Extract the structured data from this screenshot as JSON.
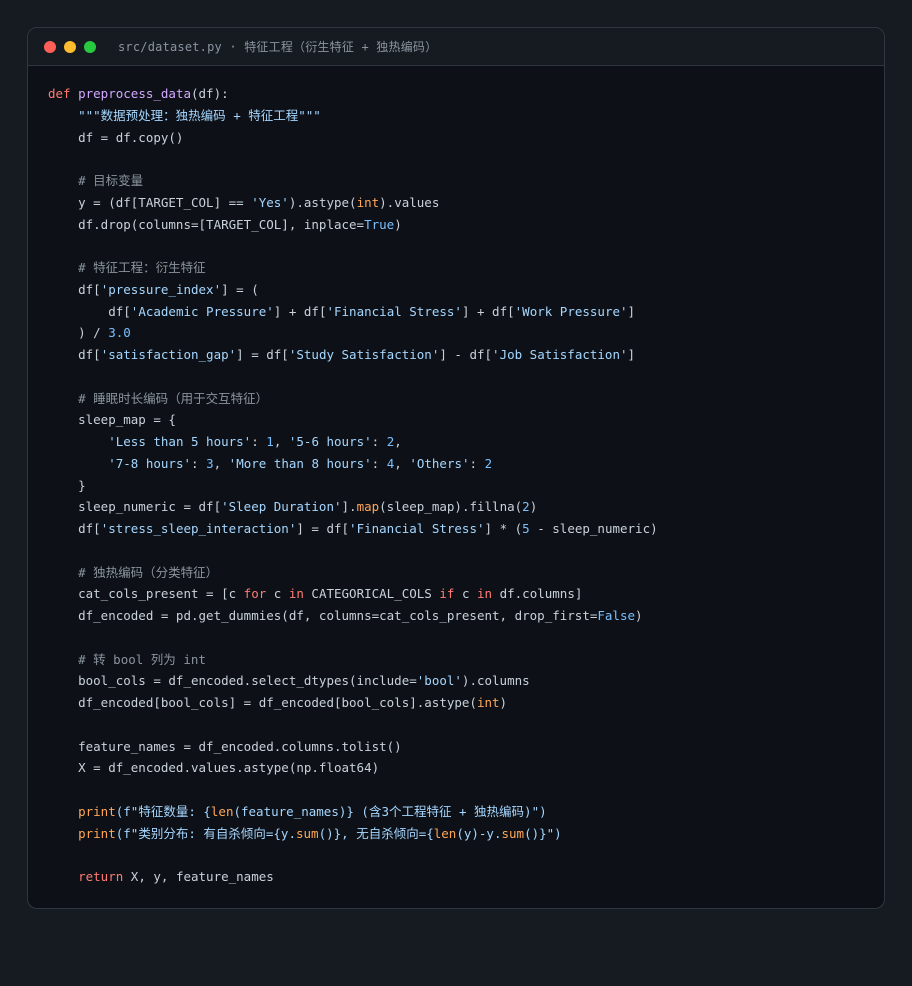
{
  "window": {
    "title": "src/dataset.py · 特征工程（衍生特征 + 独热编码）",
    "dots": [
      {
        "name": "close",
        "color": "#ff5f57"
      },
      {
        "name": "minimize",
        "color": "#febc2e"
      },
      {
        "name": "maximize",
        "color": "#28c840"
      }
    ]
  },
  "code": {
    "lines": [
      [
        {
          "t": "def ",
          "c": "kw"
        },
        {
          "t": "preprocess_data",
          "c": "fn"
        },
        {
          "t": "(df):",
          "c": ""
        }
      ],
      [
        {
          "t": "    \"\"\"数据预处理：独热编码 + 特征工程\"\"\"",
          "c": "str"
        }
      ],
      [
        {
          "t": "    df = df.copy()",
          "c": ""
        }
      ],
      [],
      [
        {
          "t": "    # 目标变量",
          "c": "cm"
        }
      ],
      [
        {
          "t": "    y = (df[TARGET_COL] == ",
          "c": ""
        },
        {
          "t": "'Yes'",
          "c": "str"
        },
        {
          "t": ").astype(",
          "c": ""
        },
        {
          "t": "int",
          "c": "bi"
        },
        {
          "t": ").values",
          "c": ""
        }
      ],
      [
        {
          "t": "    df.drop(columns=[TARGET_COL], inplace=",
          "c": ""
        },
        {
          "t": "True",
          "c": "const"
        },
        {
          "t": ")",
          "c": ""
        }
      ],
      [],
      [
        {
          "t": "    # 特征工程：衍生特征",
          "c": "cm"
        }
      ],
      [
        {
          "t": "    df[",
          "c": ""
        },
        {
          "t": "'pressure_index'",
          "c": "str"
        },
        {
          "t": "] = (",
          "c": ""
        }
      ],
      [
        {
          "t": "        df[",
          "c": ""
        },
        {
          "t": "'Academic Pressure'",
          "c": "str"
        },
        {
          "t": "] + df[",
          "c": ""
        },
        {
          "t": "'Financial Stress'",
          "c": "str"
        },
        {
          "t": "] + df[",
          "c": ""
        },
        {
          "t": "'Work Pressure'",
          "c": "str"
        },
        {
          "t": "]",
          "c": ""
        }
      ],
      [
        {
          "t": "    ) / ",
          "c": ""
        },
        {
          "t": "3.0",
          "c": "num"
        }
      ],
      [
        {
          "t": "    df[",
          "c": ""
        },
        {
          "t": "'satisfaction_gap'",
          "c": "str"
        },
        {
          "t": "] = df[",
          "c": ""
        },
        {
          "t": "'Study Satisfaction'",
          "c": "str"
        },
        {
          "t": "] - df[",
          "c": ""
        },
        {
          "t": "'Job Satisfaction'",
          "c": "str"
        },
        {
          "t": "]",
          "c": ""
        }
      ],
      [],
      [
        {
          "t": "    # 睡眠时长编码（用于交互特征）",
          "c": "cm"
        }
      ],
      [
        {
          "t": "    sleep_map = {",
          "c": ""
        }
      ],
      [
        {
          "t": "        ",
          "c": ""
        },
        {
          "t": "'Less than 5 hours'",
          "c": "str"
        },
        {
          "t": ": ",
          "c": ""
        },
        {
          "t": "1",
          "c": "num"
        },
        {
          "t": ", ",
          "c": ""
        },
        {
          "t": "'5-6 hours'",
          "c": "str"
        },
        {
          "t": ": ",
          "c": ""
        },
        {
          "t": "2",
          "c": "num"
        },
        {
          "t": ",",
          "c": ""
        }
      ],
      [
        {
          "t": "        ",
          "c": ""
        },
        {
          "t": "'7-8 hours'",
          "c": "str"
        },
        {
          "t": ": ",
          "c": ""
        },
        {
          "t": "3",
          "c": "num"
        },
        {
          "t": ", ",
          "c": ""
        },
        {
          "t": "'More than 8 hours'",
          "c": "str"
        },
        {
          "t": ": ",
          "c": ""
        },
        {
          "t": "4",
          "c": "num"
        },
        {
          "t": ", ",
          "c": ""
        },
        {
          "t": "'Others'",
          "c": "str"
        },
        {
          "t": ": ",
          "c": ""
        },
        {
          "t": "2",
          "c": "num"
        }
      ],
      [
        {
          "t": "    }",
          "c": ""
        }
      ],
      [
        {
          "t": "    sleep_numeric = df[",
          "c": ""
        },
        {
          "t": "'Sleep Duration'",
          "c": "str"
        },
        {
          "t": "].",
          "c": ""
        },
        {
          "t": "map",
          "c": "bi"
        },
        {
          "t": "(sleep_map).fillna(",
          "c": ""
        },
        {
          "t": "2",
          "c": "num"
        },
        {
          "t": ")",
          "c": ""
        }
      ],
      [
        {
          "t": "    df[",
          "c": ""
        },
        {
          "t": "'stress_sleep_interaction'",
          "c": "str"
        },
        {
          "t": "] = df[",
          "c": ""
        },
        {
          "t": "'Financial Stress'",
          "c": "str"
        },
        {
          "t": "] * (",
          "c": ""
        },
        {
          "t": "5",
          "c": "num"
        },
        {
          "t": " - sleep_numeric)",
          "c": ""
        }
      ],
      [],
      [
        {
          "t": "    # 独热编码（分类特征）",
          "c": "cm"
        }
      ],
      [
        {
          "t": "    cat_cols_present = [c ",
          "c": ""
        },
        {
          "t": "for",
          "c": "kw"
        },
        {
          "t": " c ",
          "c": ""
        },
        {
          "t": "in",
          "c": "kw"
        },
        {
          "t": " CATEGORICAL_COLS ",
          "c": ""
        },
        {
          "t": "if",
          "c": "kw"
        },
        {
          "t": " c ",
          "c": ""
        },
        {
          "t": "in",
          "c": "kw"
        },
        {
          "t": " df.columns]",
          "c": ""
        }
      ],
      [
        {
          "t": "    df_encoded = pd.get_dummies(df, columns=cat_cols_present, drop_first=",
          "c": ""
        },
        {
          "t": "False",
          "c": "const"
        },
        {
          "t": ")",
          "c": ""
        }
      ],
      [],
      [
        {
          "t": "    # 转 bool 列为 int",
          "c": "cm"
        }
      ],
      [
        {
          "t": "    bool_cols = df_encoded.select_dtypes(include=",
          "c": ""
        },
        {
          "t": "'bool'",
          "c": "str"
        },
        {
          "t": ").columns",
          "c": ""
        }
      ],
      [
        {
          "t": "    df_encoded[bool_cols] = df_encoded[bool_cols].astype(",
          "c": ""
        },
        {
          "t": "int",
          "c": "bi"
        },
        {
          "t": ")",
          "c": ""
        }
      ],
      [],
      [
        {
          "t": "    feature_names = df_encoded.columns.tolist()",
          "c": ""
        }
      ],
      [
        {
          "t": "    X = df_encoded.values.astype(np.float64)",
          "c": ""
        }
      ],
      [],
      [
        {
          "t": "    ",
          "c": ""
        },
        {
          "t": "print",
          "c": "bi"
        },
        {
          "t": "(f\"特征数量: {",
          "c": "str"
        },
        {
          "t": "len",
          "c": "bi"
        },
        {
          "t": "(feature_names)} (含3个工程特征 + 独热编码)\")",
          "c": "str"
        }
      ],
      [
        {
          "t": "    ",
          "c": ""
        },
        {
          "t": "print",
          "c": "bi"
        },
        {
          "t": "(f\"类别分布: 有自杀倾向={y.",
          "c": "str"
        },
        {
          "t": "sum",
          "c": "bi"
        },
        {
          "t": "()}, 无自杀倾向={",
          "c": "str"
        },
        {
          "t": "len",
          "c": "bi"
        },
        {
          "t": "(y)-y.",
          "c": "str"
        },
        {
          "t": "sum",
          "c": "bi"
        },
        {
          "t": "()}\")",
          "c": "str"
        }
      ],
      [],
      [
        {
          "t": "    ",
          "c": ""
        },
        {
          "t": "return",
          "c": "kw"
        },
        {
          "t": " X, y, feature_names",
          "c": ""
        }
      ]
    ]
  }
}
